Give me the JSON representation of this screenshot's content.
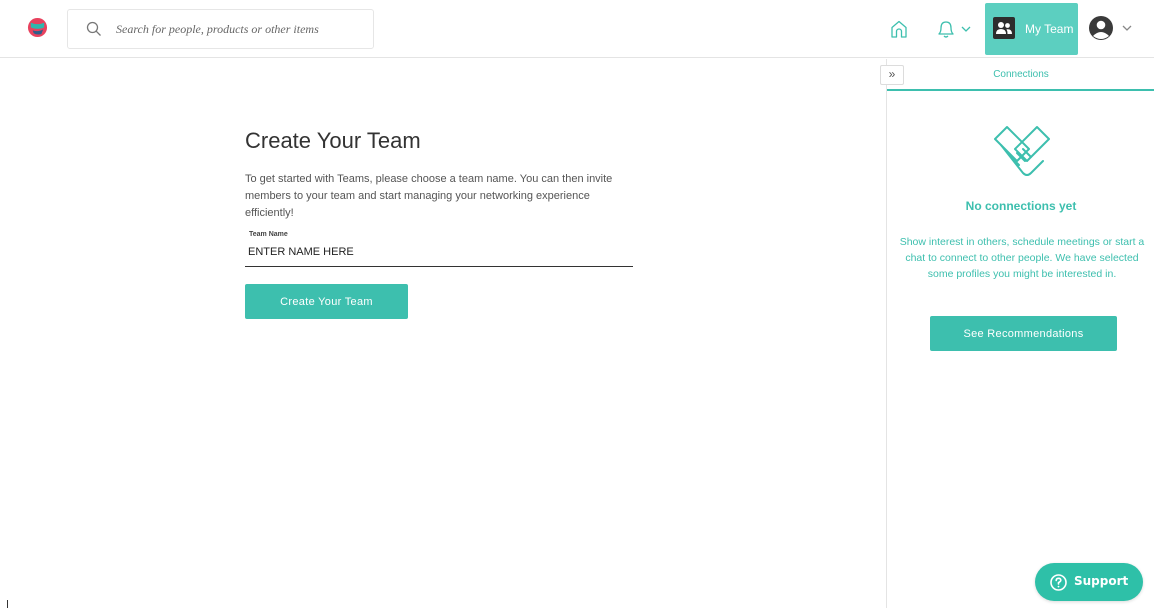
{
  "header": {
    "search_placeholder": "Search for people, products or other items",
    "my_team_label": "My Team"
  },
  "main": {
    "title": "Create Your Team",
    "intro": "To get started with Teams, please choose a team name. You can then invite members to your team and start managing your networking experience efficiently!",
    "team_name_label": "Team Name",
    "team_name_value": "ENTER NAME HERE",
    "create_button": "Create Your Team"
  },
  "panel": {
    "collapse_glyph": "»",
    "tab_label": "Connections",
    "empty_title": "No connections yet",
    "empty_text": "Show interest in others, schedule meetings or start a chat to connect to other people. We have selected some profiles you might be interested in.",
    "recommend_button": "See Recommendations"
  },
  "support": {
    "label": "Support"
  },
  "icons": {
    "logo": "brand-logo-icon",
    "search": "search-icon",
    "home": "home-icon",
    "bell": "bell-icon",
    "team": "team-icon",
    "avatar": "user-avatar-icon",
    "handshake": "handshake-icon",
    "help": "help-icon"
  },
  "colors": {
    "accent": "#3dbfae",
    "my_team_bg": "#5ccfc0",
    "support_bg": "#2ec0a8",
    "logo_pink": "#e8425e",
    "logo_teal": "#2fb8ad"
  }
}
